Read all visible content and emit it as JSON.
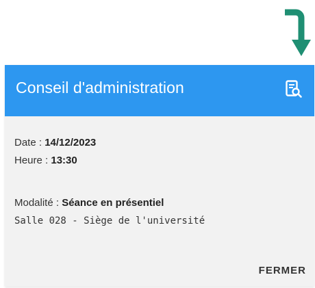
{
  "dialog": {
    "title": "Conseil d'administration",
    "header_icon": "document-search-icon",
    "close_label": "FERMER"
  },
  "details": {
    "date_label": "Date : ",
    "date_value": "14/12/2023",
    "time_label": "Heure : ",
    "time_value": "13:30",
    "mode_label": "Modalité : ",
    "mode_value": "Séance en présentiel",
    "location": "Salle 028 - Siège de l'université"
  },
  "colors": {
    "header_bg": "#2d97f0",
    "arrow": "#1f8f73",
    "body_bg": "#f2f2f2"
  }
}
